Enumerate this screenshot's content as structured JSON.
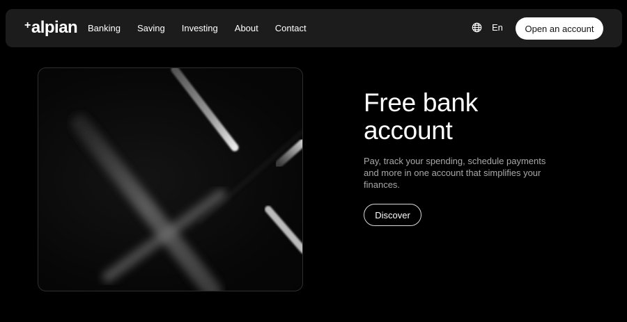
{
  "brand": {
    "logo_plus": "+",
    "logo_text": "alpian"
  },
  "nav": {
    "items": [
      {
        "label": "Banking"
      },
      {
        "label": "Saving"
      },
      {
        "label": "Investing"
      },
      {
        "label": "About"
      },
      {
        "label": "Contact"
      }
    ],
    "language_icon": "globe-icon",
    "language": "En",
    "cta_label": "Open an account"
  },
  "hero": {
    "title_line1": "Free bank",
    "title_line2": "account",
    "description": "Pay, track your spending, schedule payments and more in one account that simplifies your finances.",
    "button_label": "Discover"
  },
  "colors": {
    "background": "#000000",
    "nav_background": "#1c1c1c",
    "cta_background": "#ffffff",
    "description_text": "#a8a8a8"
  }
}
